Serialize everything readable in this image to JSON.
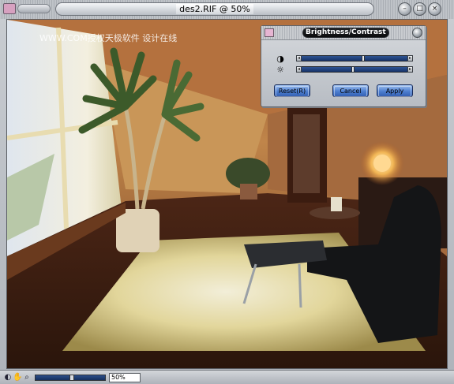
{
  "window": {
    "title": "des2.RIF @ 50%"
  },
  "watermark": "WWW.COM授权天极软件 设计在线",
  "dialog": {
    "title": "Brightness/Contrast",
    "contrast_icon": "contrast-icon",
    "brightness_icon": "brightness-icon",
    "contrast_level": 0.58,
    "brightness_level": 0.48,
    "buttons": {
      "reset": "Reset(R)",
      "cancel": "Cancel",
      "apply": "Apply"
    }
  },
  "statusbar": {
    "zoom_value": "50%",
    "zoom_level": 0.5
  },
  "colors": {
    "accent": "#3a67b8",
    "titlebar_dark": "#111316"
  }
}
